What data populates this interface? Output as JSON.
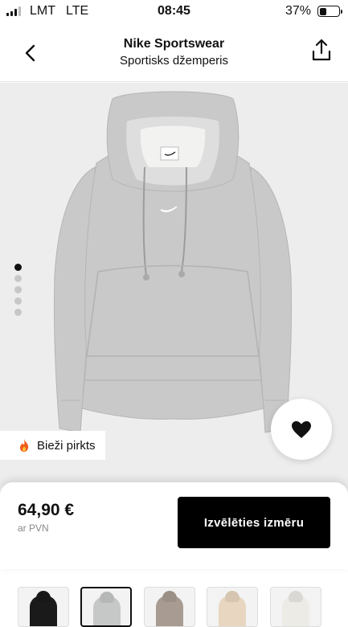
{
  "status_bar": {
    "carrier": "LMT",
    "network": "LTE",
    "time": "08:45",
    "battery_percent": "37%",
    "battery_level": 0.37
  },
  "header": {
    "brand": "Nike Sportswear",
    "product_name": "Sportisks džemperis",
    "back_icon": "chevron-left-icon",
    "share_icon": "share-icon"
  },
  "gallery": {
    "image_count": 5,
    "active_index": 0,
    "badge_text": "Bieži pirkts",
    "badge_icon": "fire-icon",
    "favorite_icon": "heart-icon",
    "product_color": "#c9c9c9"
  },
  "purchase": {
    "price": "64,90 €",
    "vat_note": "ar PVN",
    "select_size_label": "Izvēlēties izmēru"
  },
  "variants": [
    {
      "color": "#1a1a1a",
      "selected": false
    },
    {
      "color": "#c6c8c7",
      "selected": true
    },
    {
      "color": "#a89c92",
      "selected": false
    },
    {
      "color": "#e8d6c0",
      "selected": false
    },
    {
      "color": "#ecebe6",
      "selected": false
    }
  ]
}
